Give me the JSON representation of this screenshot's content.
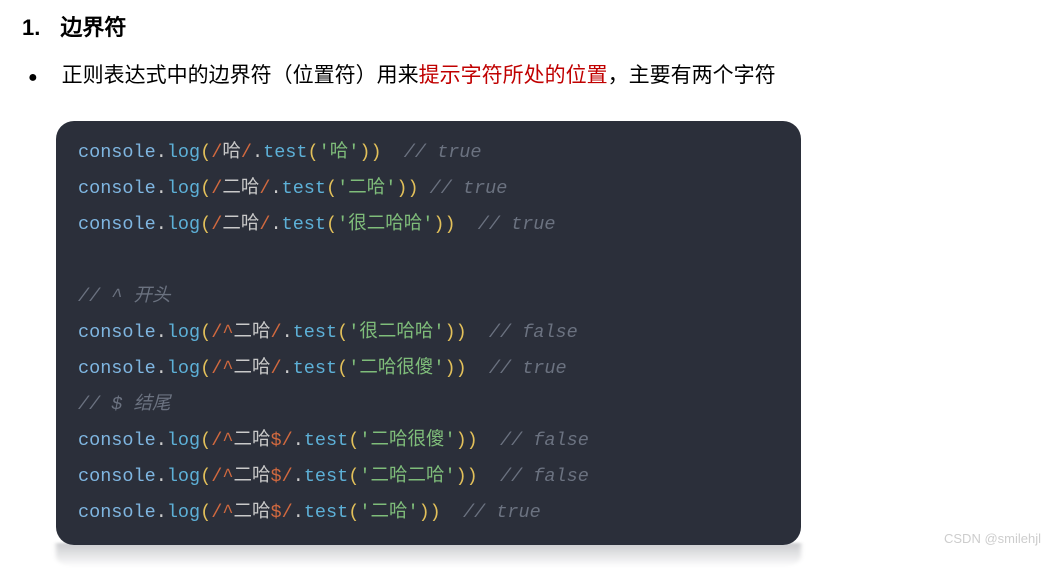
{
  "heading": {
    "number": "1.",
    "text": "边界符"
  },
  "bullet": {
    "prefix": "正则表达式中的边界符（位置符）用来",
    "highlight": "提示字符所处的位置",
    "suffix": "，主要有两个字符"
  },
  "code": {
    "lines": [
      {
        "type": "call",
        "regex_prefix": "/",
        "regex_body": "哈",
        "regex_suffix": "/",
        "arg": "'哈'",
        "spacing_after_paren": "  ",
        "comment": "// true"
      },
      {
        "type": "call",
        "regex_prefix": "/",
        "regex_body": "二哈",
        "regex_suffix": "/",
        "arg": "'二哈'",
        "spacing_after_paren": " ",
        "comment": "// true"
      },
      {
        "type": "call",
        "regex_prefix": "/",
        "regex_body": "二哈",
        "regex_suffix": "/",
        "arg": "'很二哈哈'",
        "spacing_after_paren": "  ",
        "comment": "// true"
      },
      {
        "type": "blank"
      },
      {
        "type": "comment",
        "text": "// ^ 开头"
      },
      {
        "type": "call",
        "regex_prefix": "/^",
        "regex_body": "二哈",
        "regex_suffix": "/",
        "arg": "'很二哈哈'",
        "spacing_after_paren": "  ",
        "comment": "// false"
      },
      {
        "type": "call",
        "regex_prefix": "/^",
        "regex_body": "二哈",
        "regex_suffix": "/",
        "arg": "'二哈很傻'",
        "spacing_after_paren": "  ",
        "comment": "// true"
      },
      {
        "type": "comment",
        "text": "// $ 结尾"
      },
      {
        "type": "call",
        "regex_prefix": "/^",
        "regex_body": "二哈",
        "regex_suffix": "$/",
        "arg": "'二哈很傻'",
        "spacing_after_paren": "  ",
        "comment": "// false"
      },
      {
        "type": "call",
        "regex_prefix": "/^",
        "regex_body": "二哈",
        "regex_suffix": "$/",
        "arg": "'二哈二哈'",
        "spacing_after_paren": "  ",
        "comment": "// false"
      },
      {
        "type": "call",
        "regex_prefix": "/^",
        "regex_body": "二哈",
        "regex_suffix": "$/",
        "arg": "'二哈'",
        "spacing_after_paren": "  ",
        "comment": "// true"
      }
    ],
    "tokens": {
      "obj": "console",
      "dot": ".",
      "method_log": "log",
      "method_test": "test",
      "open": "(",
      "close": ")"
    }
  },
  "watermark": "CSDN @smilehjl"
}
